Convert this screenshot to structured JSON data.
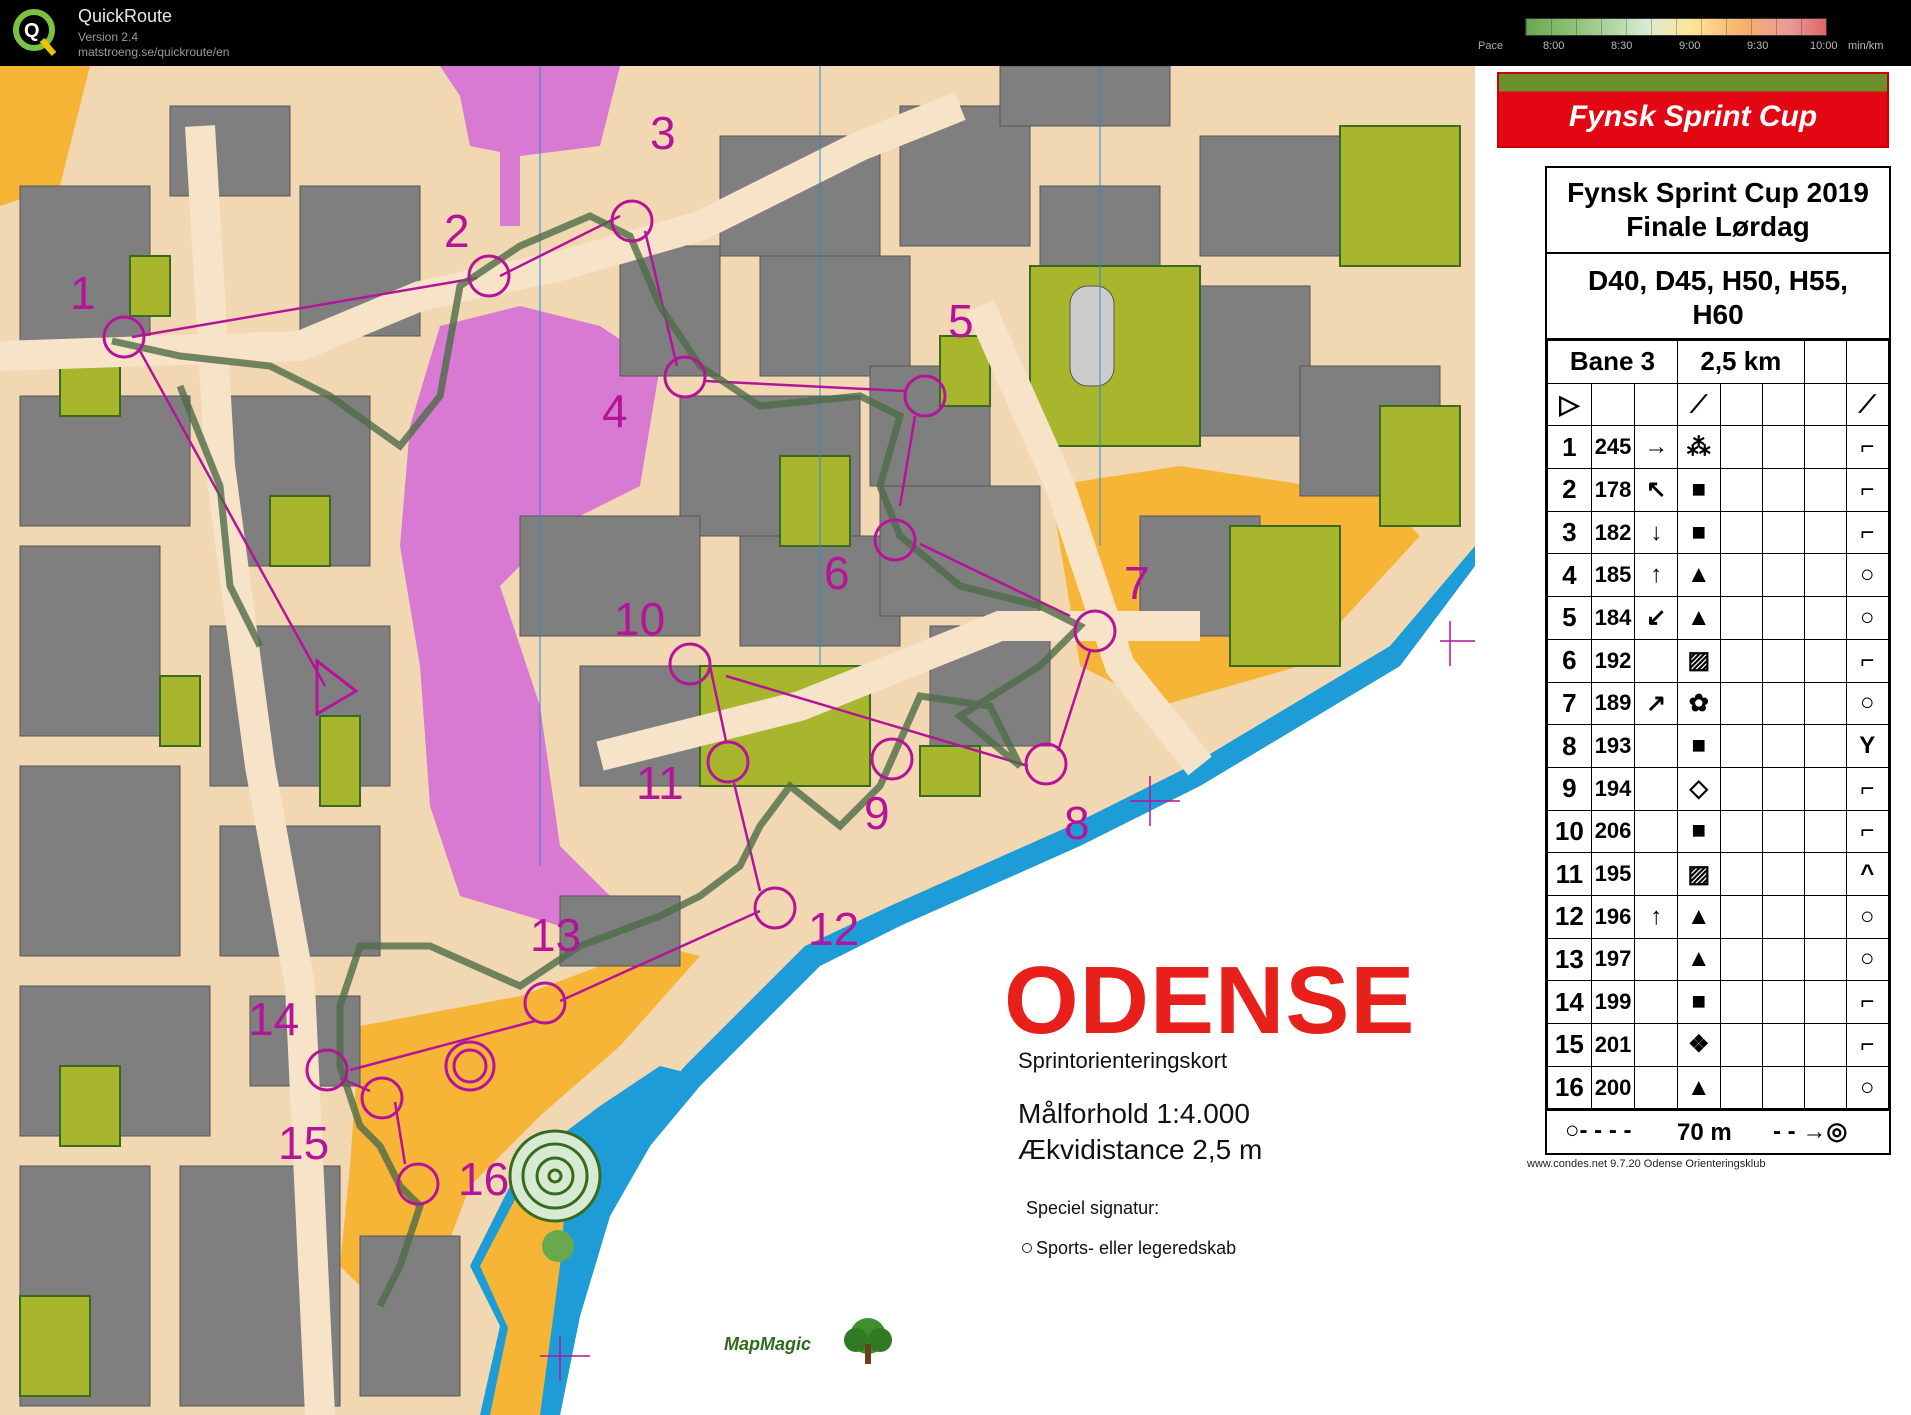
{
  "app": {
    "title": "QuickRoute",
    "version": "Version 2.4",
    "url": "matstroeng.se/quickroute/en",
    "logo_icon": "quickroute-q-logo-icon"
  },
  "pace": {
    "label": "Pace",
    "ticks": [
      "8:00",
      "8:30",
      "9:00",
      "9:30",
      "10:00"
    ],
    "unit": "min/km"
  },
  "map": {
    "city": "ODENSE",
    "subtitle": "Sprintorienteringskort",
    "scale": "Målforhold 1:4.000",
    "contour": "Ækvidistance 2,5 m",
    "special_title": "Speciel signatur:",
    "special_item": "Sports- eller legeredskab",
    "publisher": "MapMagic",
    "colors": {
      "course": "#b5149a",
      "water": "#1e9cd7",
      "route": "#4d6b47",
      "building": "#7f7f7f",
      "olive": "#a7b62c",
      "paved": "#f2d7b3",
      "magenta_area": "#d87ad2",
      "open": "#f7b538"
    },
    "controls": [
      "1",
      "2",
      "3",
      "4",
      "5",
      "6",
      "7",
      "8",
      "9",
      "10",
      "11",
      "12",
      "13",
      "14",
      "15",
      "16"
    ]
  },
  "panel": {
    "banner": "Fynsk Sprint Cup",
    "event_line1": "Fynsk Sprint Cup 2019",
    "event_line2": "Finale Lørdag",
    "classes_line1": "D40, D45, H50, H55,",
    "classes_line2": "H60",
    "course": "Bane 3",
    "length": "2,5 km",
    "rows": [
      {
        "n": "1",
        "code": "245",
        "dir": "→"
      },
      {
        "n": "2",
        "code": "178",
        "dir": "↖"
      },
      {
        "n": "3",
        "code": "182",
        "dir": "↓"
      },
      {
        "n": "4",
        "code": "185",
        "dir": "↑"
      },
      {
        "n": "5",
        "code": "184",
        "dir": "↙"
      },
      {
        "n": "6",
        "code": "192",
        "dir": ""
      },
      {
        "n": "7",
        "code": "189",
        "dir": "↗"
      },
      {
        "n": "8",
        "code": "193",
        "dir": ""
      },
      {
        "n": "9",
        "code": "194",
        "dir": ""
      },
      {
        "n": "10",
        "code": "206",
        "dir": ""
      },
      {
        "n": "11",
        "code": "195",
        "dir": ""
      },
      {
        "n": "12",
        "code": "196",
        "dir": "↑"
      },
      {
        "n": "13",
        "code": "197",
        "dir": ""
      },
      {
        "n": "14",
        "code": "199",
        "dir": ""
      },
      {
        "n": "15",
        "code": "201",
        "dir": ""
      },
      {
        "n": "16",
        "code": "200",
        "dir": ""
      }
    ],
    "finish": "70 m",
    "credit": "www.condes.net 9.7.20 Odense Orienteringsklub"
  }
}
